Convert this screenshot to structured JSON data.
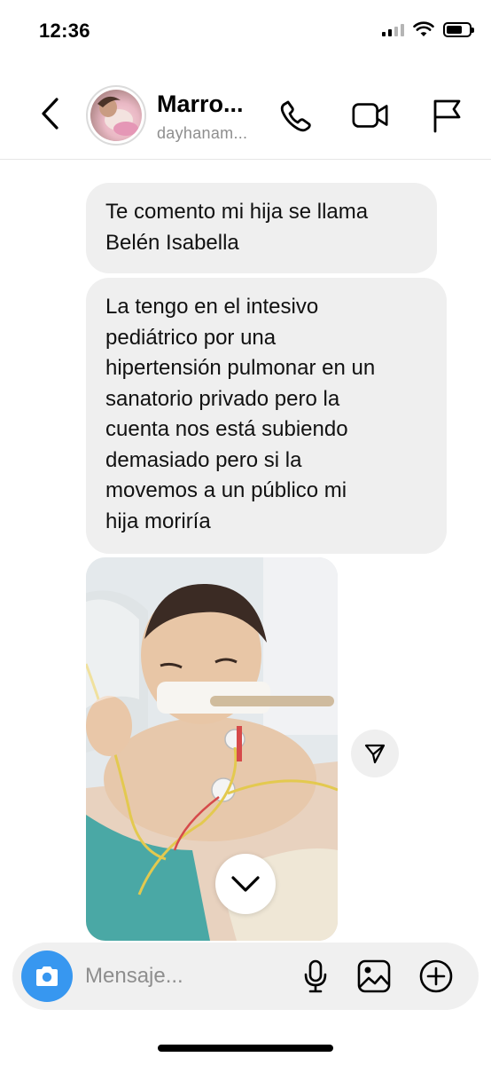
{
  "status_bar": {
    "time": "12:36",
    "icons": [
      "cellular-signal-icon",
      "wifi-icon",
      "battery-icon"
    ]
  },
  "header": {
    "contact_name": "Marro...",
    "contact_handle": "dayhanam...",
    "icons": [
      "chevron-left-icon",
      "phone-icon",
      "video-camera-icon",
      "flag-icon"
    ]
  },
  "messages": [
    {
      "type": "text",
      "text": "Te comento mi hija se llama\nBelén Isabella"
    },
    {
      "type": "text",
      "text": "La tengo en el intesivo\npediátrico por una\nhipertensión pulmonar en un\nsanatorio privado pero la\ncuenta nos está subiendo\ndemasiado pero si la\nmovemos a un público mi\nhija moriría"
    },
    {
      "type": "photo",
      "description": "photo-attachment"
    }
  ],
  "composer": {
    "placeholder": "Mensaje...",
    "icons": [
      "camera-icon",
      "microphone-icon",
      "image-icon",
      "plus-circle-icon"
    ]
  },
  "colors": {
    "accent": "#3797f0",
    "bubble": "#efefef",
    "secondary_text": "#8e8e8e"
  }
}
